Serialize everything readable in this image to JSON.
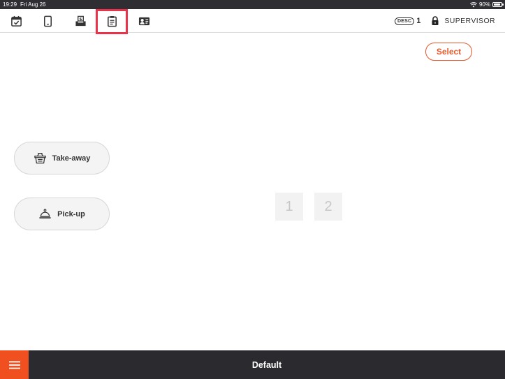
{
  "status_bar": {
    "time": "19:29",
    "date": "Fri Aug 26",
    "battery": "90%",
    "battery_level": 0.9
  },
  "toolbar": {
    "tools": [
      {
        "name": "calendar-check-icon",
        "active": false
      },
      {
        "name": "tablet-icon",
        "active": false
      },
      {
        "name": "cash-drawer-icon",
        "active": false
      },
      {
        "name": "clipboard-icon",
        "active": true
      },
      {
        "name": "customer-card-icon",
        "active": false
      }
    ],
    "desc_badge": "DESC",
    "desc_count": "1",
    "user_role": "SUPERVISOR"
  },
  "main": {
    "select_label": "Select",
    "order_types": [
      {
        "label": "Take-away",
        "icon": "basket-icon"
      },
      {
        "label": "Pick-up",
        "icon": "cloche-icon"
      }
    ],
    "tables": [
      "1",
      "2"
    ]
  },
  "bottom_bar": {
    "title": "Default",
    "menu_icon": "hamburger-menu-icon"
  },
  "colors": {
    "accent": "#f04f1f",
    "select_border": "#e8562a",
    "active_highlight": "#e8334a",
    "dark_bar": "#2b2b2f"
  }
}
